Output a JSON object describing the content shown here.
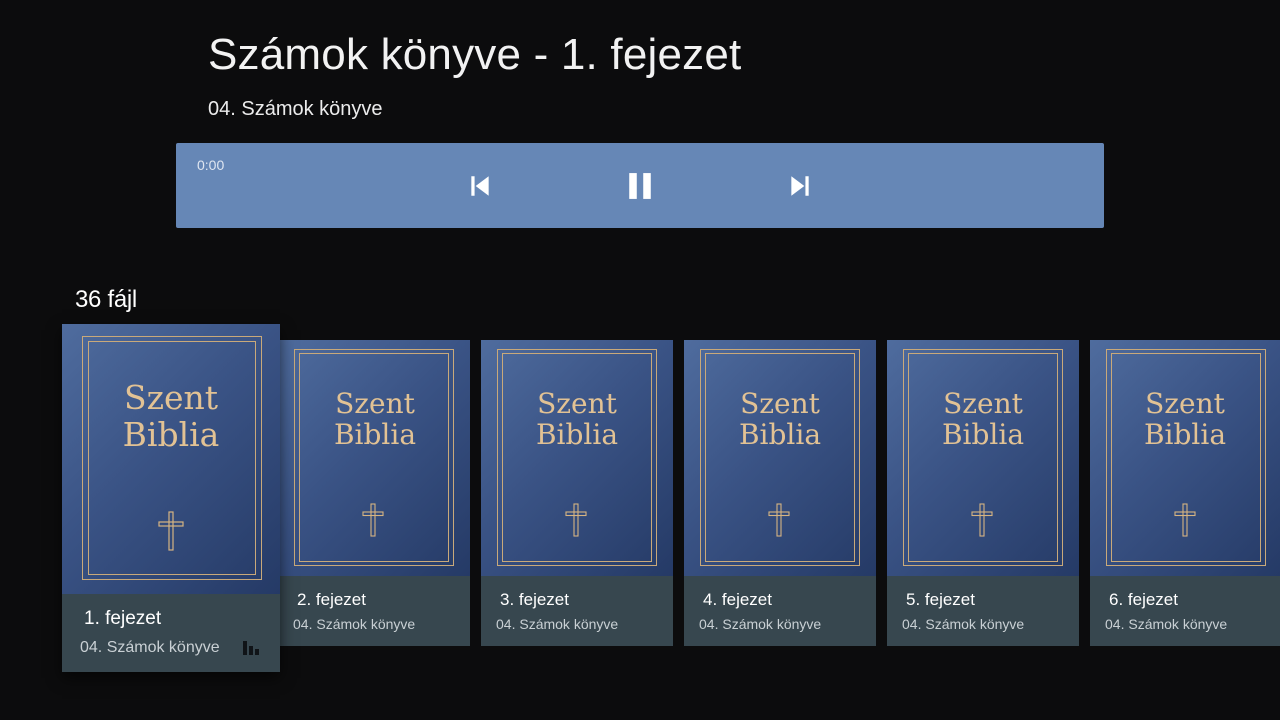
{
  "header": {
    "title": "Számok könyve - 1. fejezet",
    "subtitle": "04. Számok könyve"
  },
  "player": {
    "time": "0:00",
    "controls": {
      "previous": "skip-previous-icon",
      "pause": "pause-icon",
      "next": "skip-next-icon"
    },
    "background": "#6687b6"
  },
  "list": {
    "count_label": "36 fájl",
    "items": [
      {
        "cover_line1": "Szent",
        "cover_line2": "Biblia",
        "title": "1. fejezet",
        "subtitle": "04. Számok könyve",
        "playing": true
      },
      {
        "cover_line1": "Szent",
        "cover_line2": "Biblia",
        "title": "2. fejezet",
        "subtitle": "04. Számok könyve"
      },
      {
        "cover_line1": "Szent",
        "cover_line2": "Biblia",
        "title": "3. fejezet",
        "subtitle": "04. Számok könyve"
      },
      {
        "cover_line1": "Szent",
        "cover_line2": "Biblia",
        "title": "4. fejezet",
        "subtitle": "04. Számok könyve"
      },
      {
        "cover_line1": "Szent",
        "cover_line2": "Biblia",
        "title": "5. fejezet",
        "subtitle": "04. Számok könyve"
      },
      {
        "cover_line1": "Szent",
        "cover_line2": "Biblia",
        "title": "6. fejezet",
        "subtitle": "04. Számok könyve"
      }
    ]
  },
  "colors": {
    "background": "#0c0c0d",
    "card_info": "#37474f",
    "cover_gold": "#c9a97a"
  }
}
